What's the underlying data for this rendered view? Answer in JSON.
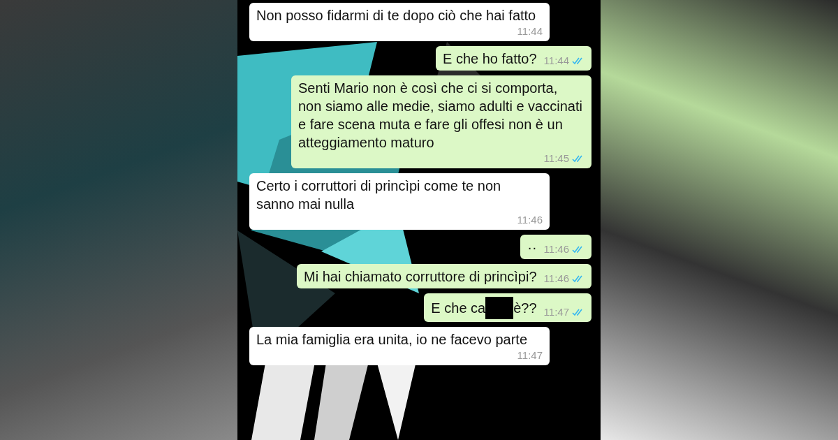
{
  "messages": [
    {
      "kind": "incoming",
      "parts": [
        {
          "kind": "text",
          "text": "Non posso fidarmi di te dopo ciò che hai fatto"
        }
      ],
      "time": "11:44"
    },
    {
      "kind": "outgoing",
      "parts": [
        {
          "kind": "text",
          "text": "E che ho fatto?"
        }
      ],
      "time": "11:44",
      "read": true
    },
    {
      "kind": "outgoing",
      "parts": [
        {
          "kind": "text",
          "text": "Senti Mario non è così che ci si comporta, non siamo alle medie, siamo adulti e vaccinati e fare scena muta e fare gli offesi non è un atteggiamento maturo"
        }
      ],
      "time": "11:45",
      "read": true
    },
    {
      "kind": "incoming",
      "parts": [
        {
          "kind": "text",
          "text": "Certo i corruttori di princìpi come te non sanno mai nulla"
        }
      ],
      "time": "11:46"
    },
    {
      "kind": "outgoing",
      "parts": [
        {
          "kind": "text",
          "text": "··"
        }
      ],
      "time": "11:46",
      "read": true
    },
    {
      "kind": "outgoing",
      "parts": [
        {
          "kind": "text",
          "text": "Mi hai chiamato corruttore di princìpi?"
        }
      ],
      "time": "11:46",
      "read": true
    },
    {
      "kind": "outgoing",
      "parts": [
        {
          "kind": "text",
          "text": "E che ca"
        },
        {
          "kind": "redaction"
        },
        {
          "kind": "text",
          "text": "è??"
        }
      ],
      "time": "11:47",
      "read": true
    },
    {
      "kind": "incoming",
      "parts": [
        {
          "kind": "text",
          "text": "La mia famiglia era unita, io ne facevo parte"
        }
      ],
      "time": "11:47"
    }
  ]
}
